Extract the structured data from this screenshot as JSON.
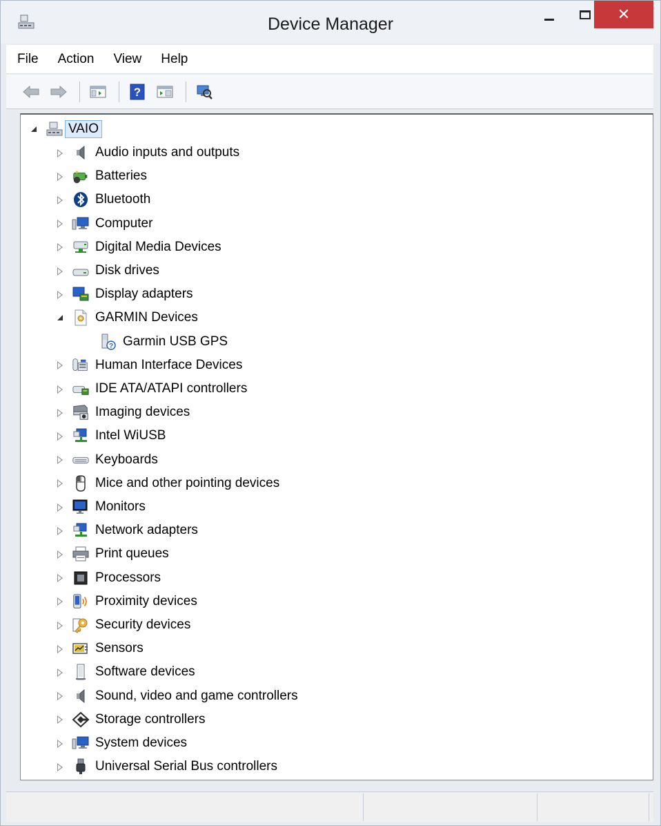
{
  "window": {
    "title": "Device Manager",
    "close_glyph": "✕"
  },
  "menu": [
    "File",
    "Action",
    "View",
    "Help"
  ],
  "toolbar": {
    "buttons": [
      "back-arrow-icon",
      "forward-arrow-icon",
      "show-hide-console-tree-icon",
      "help-icon",
      "properties-icon",
      "scan-hardware-icon"
    ]
  },
  "tree": {
    "root": {
      "label": "VAIO",
      "icon": "computer-icon",
      "expanded": true
    },
    "categories": [
      {
        "label": "Audio inputs and outputs",
        "icon": "speaker-icon",
        "expanded": false
      },
      {
        "label": "Batteries",
        "icon": "battery-icon",
        "expanded": false
      },
      {
        "label": "Bluetooth",
        "icon": "bluetooth-icon",
        "expanded": false
      },
      {
        "label": "Computer",
        "icon": "computer-monitor-icon",
        "expanded": false
      },
      {
        "label": "Digital Media Devices",
        "icon": "media-device-icon",
        "expanded": false
      },
      {
        "label": "Disk drives",
        "icon": "disk-drive-icon",
        "expanded": false
      },
      {
        "label": "Display adapters",
        "icon": "display-adapter-icon",
        "expanded": false
      },
      {
        "label": "GARMIN Devices",
        "icon": "garmin-device-icon",
        "expanded": true,
        "children": [
          {
            "label": "Garmin USB GPS",
            "icon": "unknown-device-icon"
          }
        ]
      },
      {
        "label": "Human Interface Devices",
        "icon": "hid-icon",
        "expanded": false
      },
      {
        "label": "IDE ATA/ATAPI controllers",
        "icon": "ide-controller-icon",
        "expanded": false
      },
      {
        "label": "Imaging devices",
        "icon": "scanner-icon",
        "expanded": false
      },
      {
        "label": "Intel WiUSB",
        "icon": "network-icon",
        "expanded": false
      },
      {
        "label": "Keyboards",
        "icon": "keyboard-icon",
        "expanded": false
      },
      {
        "label": "Mice and other pointing devices",
        "icon": "mouse-icon",
        "expanded": false
      },
      {
        "label": "Monitors",
        "icon": "monitor-icon",
        "expanded": false
      },
      {
        "label": "Network adapters",
        "icon": "network-adapter-icon",
        "expanded": false
      },
      {
        "label": "Print queues",
        "icon": "printer-icon",
        "expanded": false
      },
      {
        "label": "Processors",
        "icon": "processor-icon",
        "expanded": false
      },
      {
        "label": "Proximity devices",
        "icon": "proximity-icon",
        "expanded": false
      },
      {
        "label": "Security devices",
        "icon": "security-key-icon",
        "expanded": false
      },
      {
        "label": "Sensors",
        "icon": "sensor-icon",
        "expanded": false
      },
      {
        "label": "Software devices",
        "icon": "software-device-icon",
        "expanded": false
      },
      {
        "label": "Sound, video and game controllers",
        "icon": "sound-icon",
        "expanded": false
      },
      {
        "label": "Storage controllers",
        "icon": "storage-controller-icon",
        "expanded": false
      },
      {
        "label": "System devices",
        "icon": "system-device-icon",
        "expanded": false
      },
      {
        "label": "Universal Serial Bus controllers",
        "icon": "usb-icon",
        "expanded": false
      }
    ]
  },
  "colors": {
    "close_button": "#c7383a",
    "selection_border": "#7fb7e8",
    "selection_fill": "#dcecfc"
  }
}
